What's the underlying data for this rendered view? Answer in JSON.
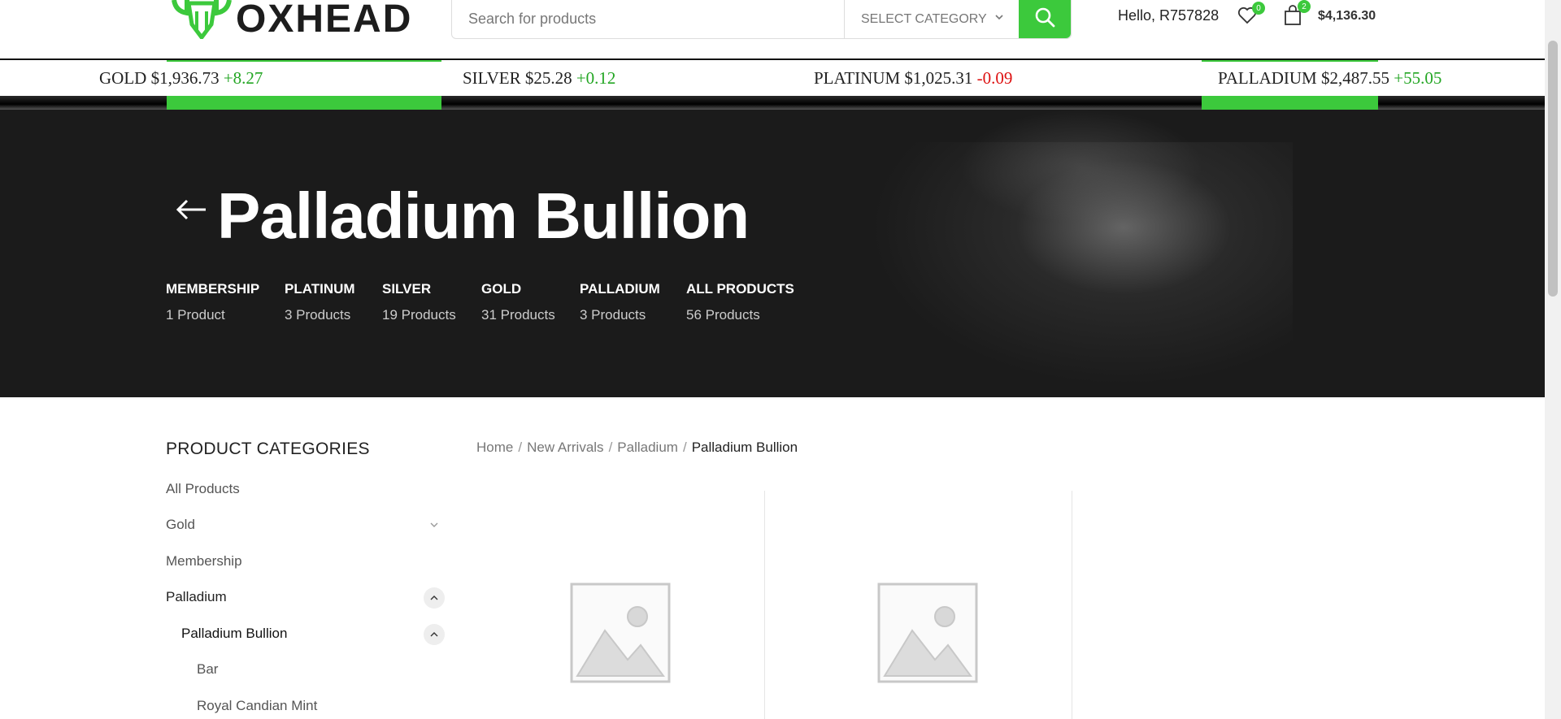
{
  "header": {
    "brand": "OXHEAD",
    "search_placeholder": "Search for products",
    "category_select": "SELECT CATEGORY",
    "greeting": "Hello, R757828",
    "wishlist_count": "0",
    "cart_count": "2",
    "cart_total": "$4,136.30",
    "accent_color": "#3cc93c"
  },
  "ticker": [
    {
      "metal": "GOLD",
      "price": "$1,936.73",
      "change": "+8.27",
      "direction": "up"
    },
    {
      "metal": "SILVER",
      "price": "$25.28",
      "change": "+0.12",
      "direction": "up"
    },
    {
      "metal": "PLATINUM",
      "price": "$1,025.31",
      "change": "-0.09",
      "direction": "down"
    },
    {
      "metal": "PALLADIUM",
      "price": "$2,487.55",
      "change": "+55.05",
      "direction": "up"
    }
  ],
  "hero": {
    "title": "Palladium Bullion",
    "categories": [
      {
        "name": "MEMBERSHIP",
        "count": "1 Product"
      },
      {
        "name": "PLATINUM",
        "count": "3 Products"
      },
      {
        "name": "SILVER",
        "count": "19 Products"
      },
      {
        "name": "GOLD",
        "count": "31 Products"
      },
      {
        "name": "PALLADIUM",
        "count": "3 Products"
      },
      {
        "name": "ALL PRODUCTS",
        "count": "56 Products"
      }
    ]
  },
  "sidebar": {
    "title": "PRODUCT CATEGORIES",
    "items": [
      {
        "label": "All Products"
      },
      {
        "label": "Gold",
        "toggle": "collapsed"
      },
      {
        "label": "Membership"
      },
      {
        "label": "Palladium",
        "toggle": "expanded"
      },
      {
        "label": "Palladium Bullion",
        "toggle": "expanded"
      },
      {
        "label": "Bar"
      },
      {
        "label": "Royal Candian Mint"
      }
    ]
  },
  "breadcrumb": {
    "items": [
      "Home",
      "New Arrivals",
      "Palladium"
    ],
    "current": "Palladium Bullion"
  }
}
